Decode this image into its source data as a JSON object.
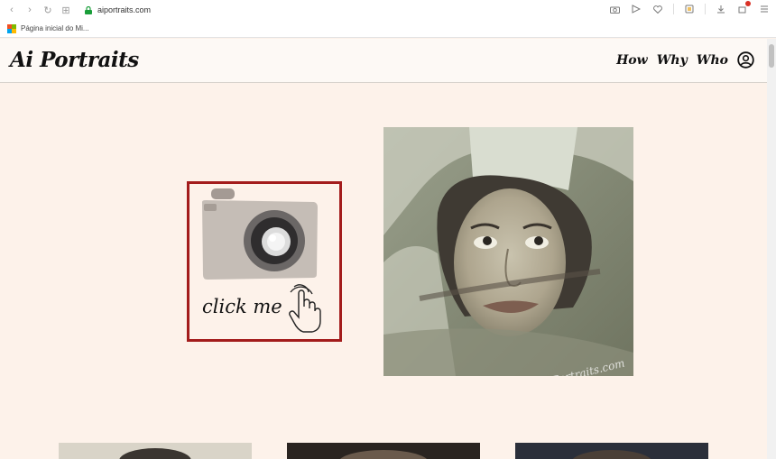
{
  "browser": {
    "url": "aiportraits.com",
    "bookmark_label": "Página inicial do Mi..."
  },
  "site": {
    "logo": "Ai Portraits",
    "nav": [
      "How",
      "Why",
      "Who"
    ]
  },
  "camera_card": {
    "label": "click me"
  },
  "portrait": {
    "watermark": "AiPortraits.com"
  },
  "colors": {
    "page_bg": "#fdf2ea",
    "highlight_border": "#a31c1c"
  }
}
